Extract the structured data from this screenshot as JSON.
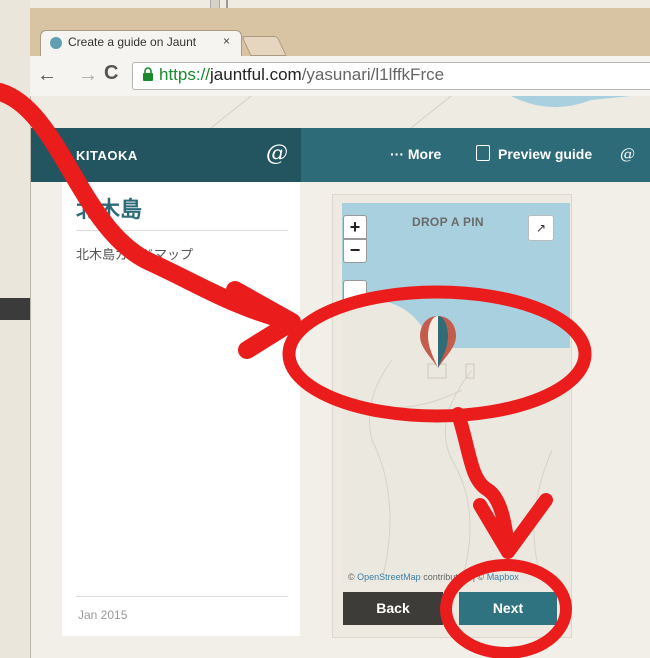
{
  "browser": {
    "tab_title": "Create a guide on Jaunt",
    "tab_close": "×",
    "url_scheme": "https://",
    "url_host": "jauntful.com",
    "url_path": "/yasunari/l1lffkFrce"
  },
  "header": {
    "brand": "KITAOKA",
    "more_label": "··· More",
    "preview_label": "Preview guide"
  },
  "guide": {
    "title": "北木島",
    "description": "北木島ガイドマップ",
    "date": "Jan 2015"
  },
  "map": {
    "drop_label": "DROP A PIN",
    "zoom_in": "+",
    "zoom_out": "−",
    "expand": "↗",
    "attrib_prefix": "© ",
    "attrib_osm": "OpenStreetMap",
    "attrib_mid": " contributors | © ",
    "attrib_mapbox": "Mapbox"
  },
  "buttons": {
    "back": "Back",
    "next": "Next"
  },
  "colors": {
    "header": "#2d6b78",
    "annotation": "#ea1c1c",
    "water": "#a9d0df"
  }
}
